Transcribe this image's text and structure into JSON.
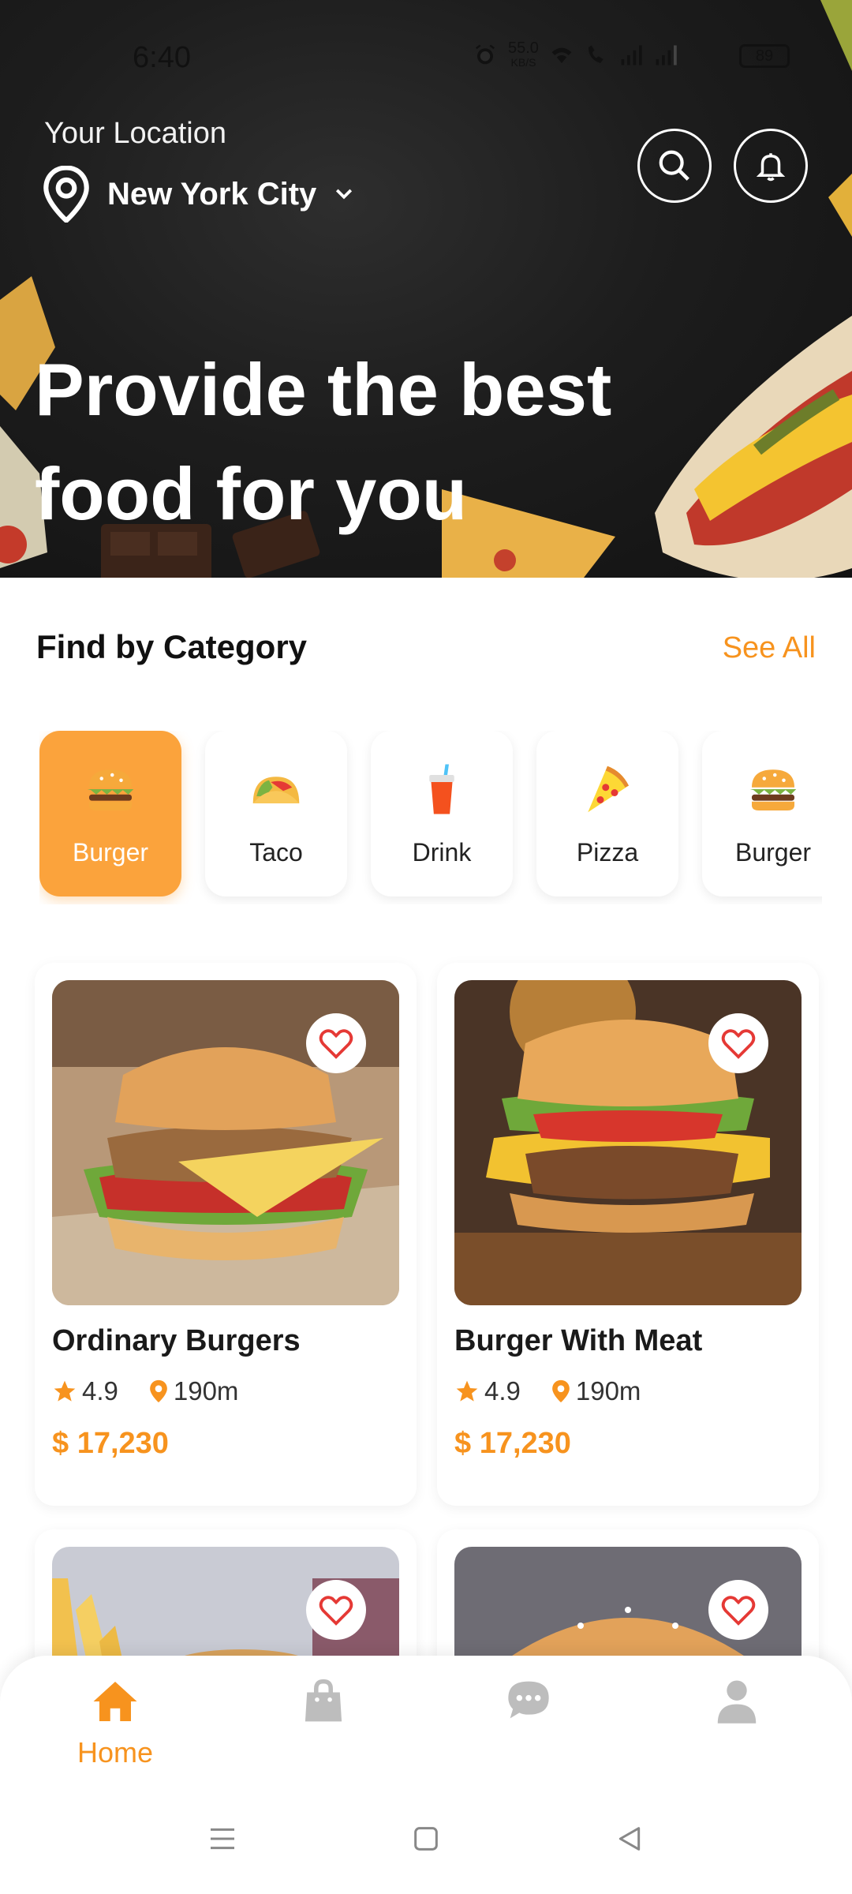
{
  "status_bar": {
    "time": "6:40",
    "speed_value": "55.0",
    "speed_unit": "KB/S",
    "battery": "89"
  },
  "header": {
    "location_label": "Your Location",
    "city": "New York City",
    "hero_line1": "Provide the best",
    "hero_line2": "food for you"
  },
  "category": {
    "title": "Find by Category",
    "see_all": "See All",
    "items": [
      {
        "label": "Burger",
        "icon": "burger-icon",
        "active": true
      },
      {
        "label": "Taco",
        "icon": "taco-icon",
        "active": false
      },
      {
        "label": "Drink",
        "icon": "drink-icon",
        "active": false
      },
      {
        "label": "Pizza",
        "icon": "pizza-icon",
        "active": false
      },
      {
        "label": "Burger",
        "icon": "burger-icon",
        "active": false
      }
    ]
  },
  "foods": [
    {
      "name": "Ordinary Burgers",
      "rating": "4.9",
      "distance": "190m",
      "price": "$ 17,230"
    },
    {
      "name": "Burger With Meat",
      "rating": "4.9",
      "distance": "190m",
      "price": "$ 17,230"
    },
    {
      "name": "",
      "rating": "",
      "distance": "",
      "price": ""
    },
    {
      "name": "",
      "rating": "",
      "distance": "",
      "price": ""
    }
  ],
  "bottom_nav": {
    "items": [
      {
        "label": "Home",
        "icon": "home-icon",
        "active": true
      },
      {
        "label": "",
        "icon": "bag-icon",
        "active": false
      },
      {
        "label": "",
        "icon": "chat-icon",
        "active": false
      },
      {
        "label": "",
        "icon": "profile-icon",
        "active": false
      }
    ]
  },
  "colors": {
    "accent": "#F7931E",
    "accent_light": "#FBA33C",
    "hero_bg": "#1d1d1d",
    "heart": "#E53935",
    "nav_inactive": "#BDBDBD"
  }
}
